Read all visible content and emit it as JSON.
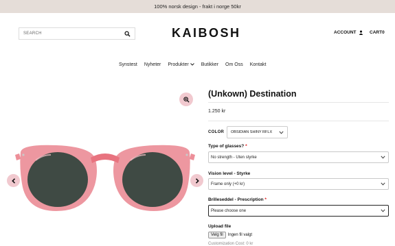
{
  "announcement": "100% norsk design - frakt i norge 50kr",
  "header": {
    "search_placeholder": "SEARCH",
    "logo": "KAIBOSH",
    "account_label": "ACCOUNT",
    "cart_label": "CART",
    "cart_count": "0"
  },
  "nav": {
    "items": [
      "Synstest",
      "Nyheter",
      "Produkter",
      "Butikker",
      "Om Oss",
      "Kontakt"
    ]
  },
  "product": {
    "title": "(Unkown) Destination",
    "price": "1.250 kr",
    "color_label": "COLOR",
    "color_value": "OBSIDIAN SHINY RFLX",
    "type_label": "Type of glasses?",
    "type_value": "No strength - Uten styrke",
    "vision_label": "Vision level - Styrke",
    "vision_value": "Frame only (+0 kr)",
    "prescription_label": "Brilleseddel - Prescription",
    "prescription_value": "Please choose one",
    "required_mark": "*",
    "upload_label": "Upload file",
    "file_button": "Velg fil",
    "file_status": "Ingen fil valgt",
    "cutoff_text": "Customization Cost: 0 kr"
  },
  "colors": {
    "announcement_bg": "#e5ddd8",
    "accent_pink": "#f1c9cf",
    "frame_pink": "#e8737f",
    "lens": "#3f4a44"
  }
}
